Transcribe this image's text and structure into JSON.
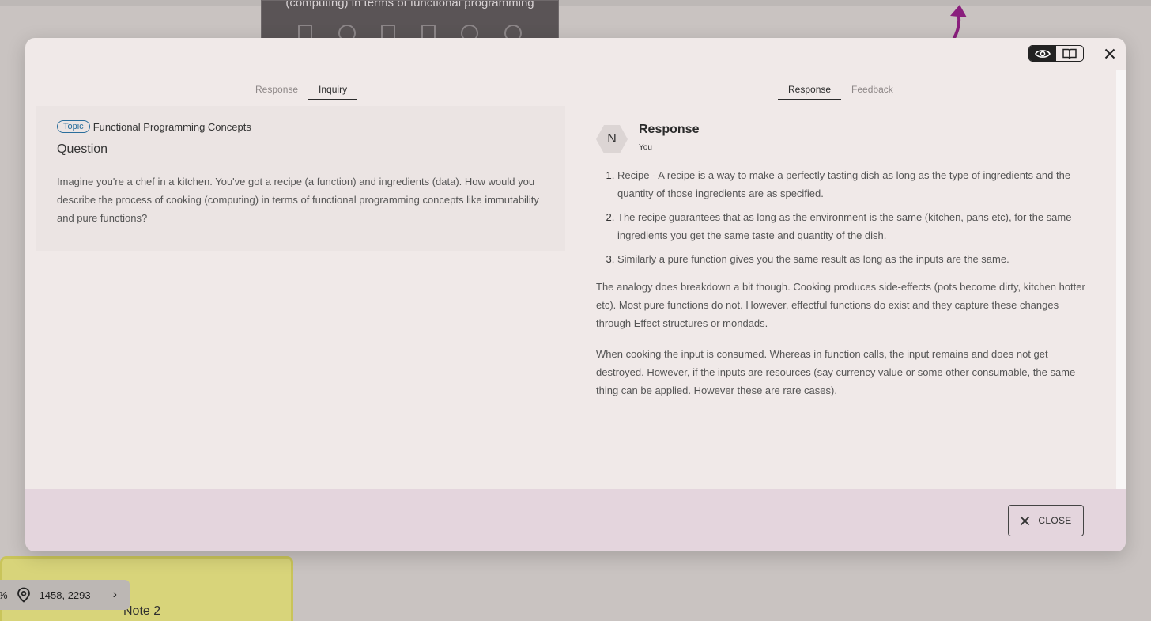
{
  "background": {
    "card_text": "(computing) in terms of functional programming",
    "note_title": "Note 2",
    "coord_prefix": "%",
    "coordinates": "1458, 2293"
  },
  "modal": {
    "left_tabs": [
      "Response",
      "Inquiry"
    ],
    "left_active": "Inquiry",
    "right_tabs": [
      "Response",
      "Feedback"
    ],
    "right_active": "Response",
    "inquiry": {
      "topic_badge": "Topic",
      "topic_title": "Functional Programming Concepts",
      "question_heading": "Question",
      "question_text": "Imagine you're a chef in a kitchen. You've got a recipe (a function) and ingredients (data). How would you describe the process of cooking (computing) in terms of functional programming concepts like immutability and pure functions?"
    },
    "response": {
      "avatar_letter": "N",
      "title": "Response",
      "author": "You",
      "list": [
        "Recipe - A recipe is a way to make a perfectly tasting dish as long as the type of ingredients and the quantity of those ingredients are as specified.",
        "The recipe guarantees that as long as the environment is the same (kitchen, pans etc), for the same ingredients you get the same taste and quantity of the dish.",
        "Similarly a pure function gives you the same result as long as the inputs are the same."
      ],
      "paragraphs": [
        "The analogy does breakdown a bit though. Cooking produces side-effects (pots become dirty, kitchen hotter etc). Most pure functions do not. However, effectful functions do exist and they capture these changes through Effect structures or mondads.",
        "When cooking the input is consumed. Whereas in function calls, the input remains and does not get destroyed. However, if the inputs are resources (say currency value or some other consumable, the same thing can be applied. However these are rare cases)."
      ]
    },
    "close_label": "CLOSE"
  },
  "colors": {
    "modal_bg": "#f0e9e8",
    "footer_bg": "#e4d5dd",
    "topic_badge": "#2a6e9c",
    "arrow_accent": "#8a1f7d"
  },
  "icons": [
    "eye-icon",
    "book-icon",
    "close-icon",
    "location-pin-icon",
    "chevron-right-icon"
  ]
}
